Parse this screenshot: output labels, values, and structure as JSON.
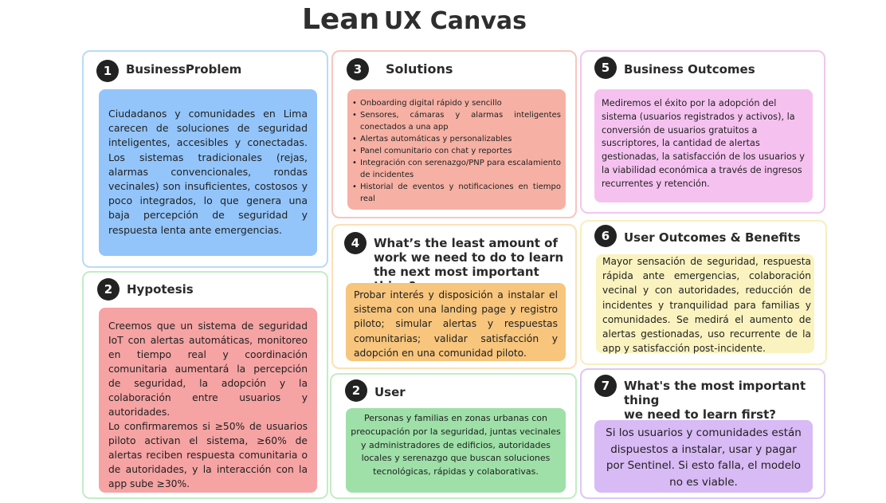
{
  "title": {
    "part1": "Lean",
    "part2": "UX Canvas"
  },
  "business_problem": {
    "number": "1",
    "heading": "BusinessProblem",
    "text": "Ciudadanos y comunidades en Lima carecen de soluciones de seguridad inteligentes, accesibles y conectadas. Los sistemas tradicionales (rejas, alarmas convencionales, rondas vecinales) son insuficientes, costosos y poco integrados, lo que genera una baja percepción de seguridad y respuesta lenta ante emergencias."
  },
  "hypotesis": {
    "number": "2",
    "heading": "Hypotesis",
    "text1": "Creemos que un sistema de seguridad IoT con alertas automáticas, monitoreo en tiempo real y coordinación comunitaria aumentará la percepción de seguridad, la adopción y la colaboración entre usuarios y autoridades.",
    "text2": "Lo confirmaremos si ≥50% de usuarios piloto activan el sistema, ≥60% de alertas reciben respuesta comunitaria o de autoridades, y la interacción con la app sube ≥30%."
  },
  "solutions": {
    "number": "3",
    "heading": "Solutions",
    "items": [
      "Onboarding digital rápido y sencillo",
      "Sensores, cámaras y alarmas inteligentes conectados a una app",
      "Alertas automáticas y personalizables",
      "Panel comunitario con chat y reportes",
      "Integración con serenazgo/PNP para escalamiento de incidentes",
      "Historial de eventos y notificaciones en tiempo real"
    ]
  },
  "least_work": {
    "number": "4",
    "heading_line1": "What’s the least amount of",
    "heading_line2": "work we need to do to learn",
    "heading_line3": "the next most important thing?",
    "text": "Probar interés y disposición a instalar el sistema con una landing page y registro piloto; simular alertas y respuestas comunitarias; validar satisfacción y adopción en una comunidad piloto."
  },
  "user": {
    "number": "2",
    "heading": "User",
    "text": "Personas y familias en zonas urbanas con preocupación por la seguridad, juntas vecinales y administradores de edificios, autoridades locales y serenazgo que buscan soluciones tecnológicas, rápidas y colaborativas."
  },
  "business_outcomes": {
    "number": "5",
    "heading": "Business Outcomes",
    "text": "Mediremos el éxito por la adopción del sistema (usuarios registrados y activos), la conversión de usuarios gratuitos a suscriptores, la cantidad de alertas gestionadas, la satisfacción de los usuarios y la viabilidad económica a través de ingresos recurrentes y retención."
  },
  "user_outcomes": {
    "number": "6",
    "heading": "User Outcomes & Benefits",
    "text": "Mayor sensación de seguridad, respuesta rápida ante emergencias, colaboración vecinal y con autoridades, reducción de incidentes y tranquilidad para familias y comunidades. Se medirá el aumento de alertas gestionadas, uso recurrente de la app y satisfacción post-incidente."
  },
  "most_important": {
    "number": "7",
    "heading_line1": "What's the most important thing",
    "heading_line2": "we need to learn first?",
    "text": "Si los usuarios y comunidades están dispuestos a instalar, usar y pagar por Sentinel. Si esto falla, el modelo no es viable."
  },
  "colors": {
    "blue_note": "#93c5fb",
    "red_note": "#f6a3a3",
    "salmon_note": "#f6b1a4",
    "orange_note": "#f7c57c",
    "green_note": "#9ee0a8",
    "pink_note": "#f5c2f0",
    "yellow_note": "#faf3bf",
    "purple_note": "#d8baf5"
  }
}
